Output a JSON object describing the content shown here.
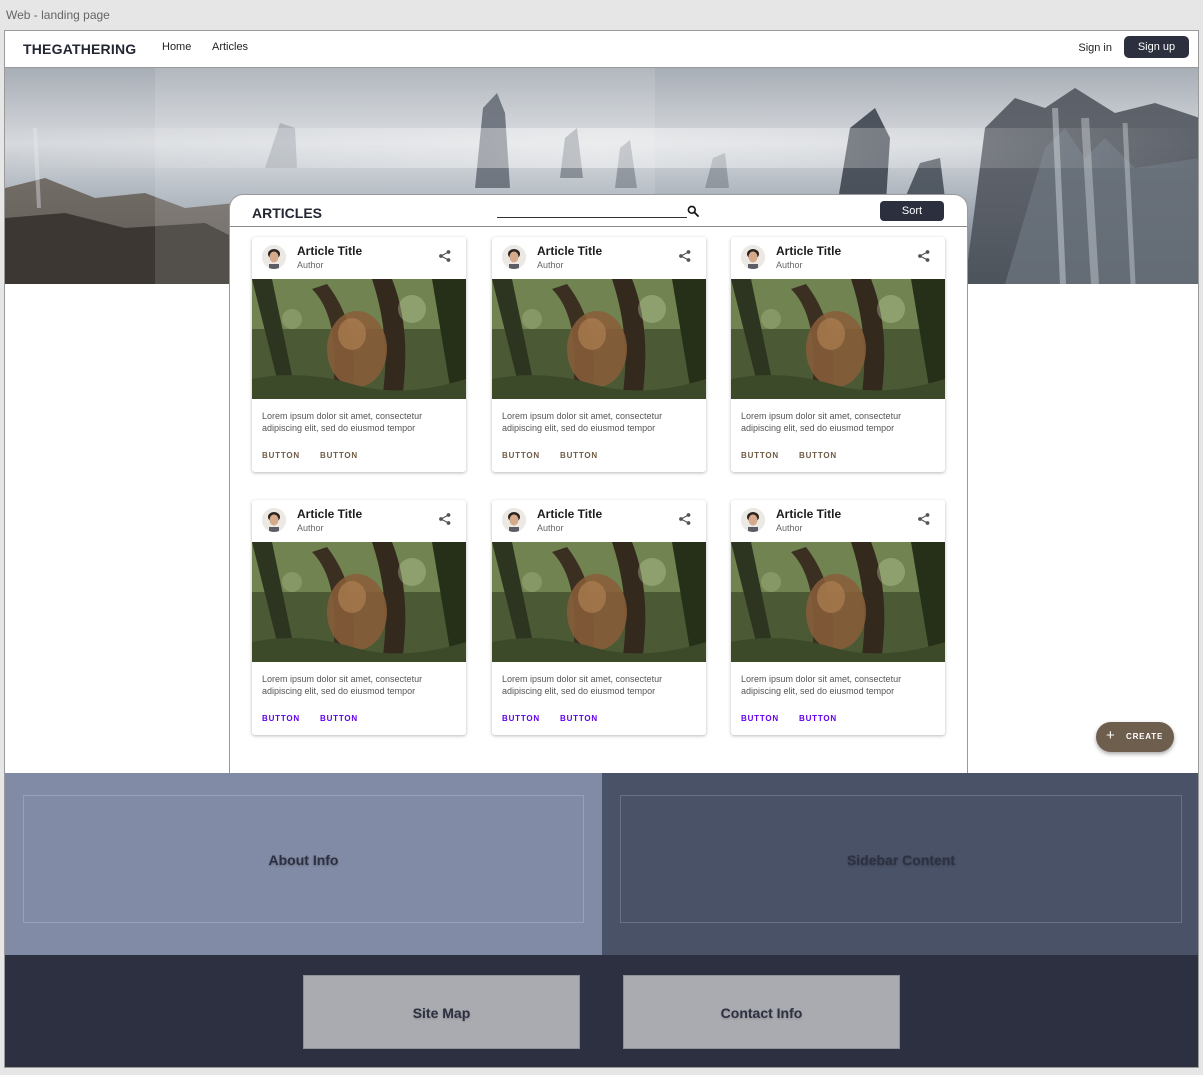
{
  "frame_label": "Web - landing page",
  "nav": {
    "brand": "THEGATHERING",
    "links": [
      "Home",
      "Articles"
    ],
    "sign_in": "Sign in",
    "sign_up": "Sign up"
  },
  "articles": {
    "title": "ARTICLES",
    "search_placeholder": "",
    "sort_label": "Sort",
    "cards": [
      {
        "title": "Article Title",
        "author": "Author",
        "text": "Lorem ipsum dolor sit amet, consectetur adipiscing elit, sed do eiusmod tempor",
        "button1": "BUTTON",
        "button2": "BUTTON"
      },
      {
        "title": "Article Title",
        "author": "Author",
        "text": "Lorem ipsum dolor sit amet, consectetur adipiscing elit, sed do eiusmod tempor",
        "button1": "BUTTON",
        "button2": "BUTTON"
      },
      {
        "title": "Article Title",
        "author": "Author",
        "text": "Lorem ipsum dolor sit amet, consectetur adipiscing elit, sed do eiusmod tempor",
        "button1": "BUTTON",
        "button2": "BUTTON"
      },
      {
        "title": "Article Title",
        "author": "Author",
        "text": "Lorem ipsum dolor sit amet, consectetur adipiscing elit, sed do eiusmod tempor",
        "button1": "BUTTON",
        "button2": "BUTTON"
      },
      {
        "title": "Article Title",
        "author": "Author",
        "text": "Lorem ipsum dolor sit amet, consectetur adipiscing elit, sed do eiusmod tempor",
        "button1": "BUTTON",
        "button2": "BUTTON"
      },
      {
        "title": "Article Title",
        "author": "Author",
        "text": "Lorem ipsum dolor sit amet, consectetur adipiscing elit, sed do eiusmod tempor",
        "button1": "BUTTON",
        "button2": "BUTTON"
      }
    ]
  },
  "fab": {
    "icon": "plus-icon",
    "label": "CREATE"
  },
  "about": {
    "label": "About Info"
  },
  "sidebar": {
    "label": "Sidebar Content"
  },
  "footer": {
    "site_map": "Site Map",
    "contact": "Contact Info"
  },
  "colors": {
    "nav_dark": "#2b2f3e",
    "about_bg": "#828ba6",
    "sidebar_bg": "#4a5268",
    "footer_bg": "#2c3040",
    "footer_box": "#aaabb0",
    "fab_bg": "#6e5e4e",
    "button_brown": "#6e5b46",
    "button_purple": "#6200ee"
  }
}
